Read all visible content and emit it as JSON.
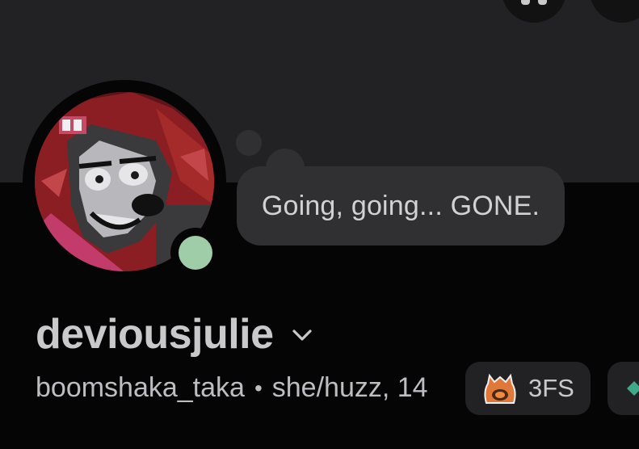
{
  "profile": {
    "display_name": "deviousjulie",
    "username": "boomshaka_taka",
    "separator": "•",
    "pronouns_age": "she/huzz, 14",
    "custom_status": "Going, going... GONE.",
    "presence": "online",
    "presence_color": "#9fcda7"
  },
  "guild_tag": {
    "label": "3FS",
    "icon": "flame-cat-icon"
  },
  "colors": {
    "banner": "#222224",
    "background": "#050505",
    "bubble": "#303033",
    "text_primary": "#c9c9cc"
  }
}
